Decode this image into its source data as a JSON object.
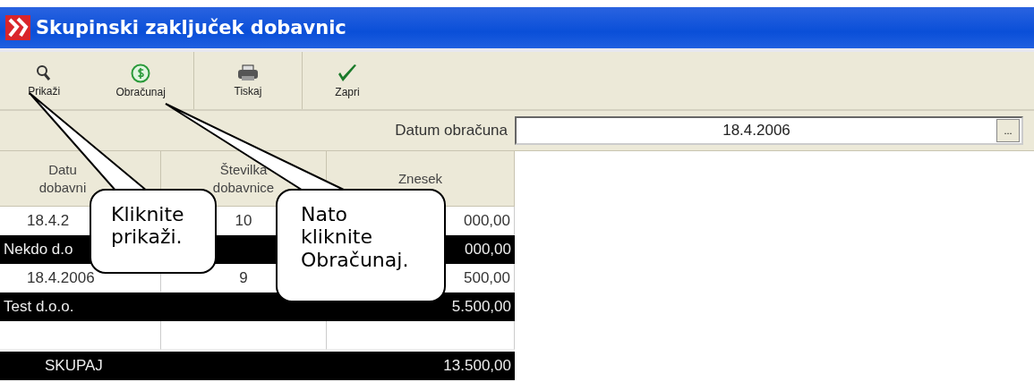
{
  "window": {
    "title": "Skupinski zaključek dobavnic"
  },
  "toolbar": [
    {
      "label": "Prikaži"
    },
    {
      "label": "Obračunaj"
    },
    {
      "label": "Tiskaj"
    },
    {
      "label": "Zapri"
    }
  ],
  "date_field": {
    "label": "Datum obračuna",
    "value": "18.4.2006",
    "button": "..."
  },
  "table": {
    "columns": [
      "Datu dobavni",
      "Številka dobavnice",
      "Znesek"
    ],
    "rows": [
      {
        "kind": "item",
        "cells": [
          "18.4.2",
          "10",
          "000,00"
        ]
      },
      {
        "kind": "group",
        "cells": [
          "Nekdo d.o",
          "000,00"
        ]
      },
      {
        "kind": "item",
        "cells": [
          "18.4.2006",
          "9",
          "500,00"
        ]
      },
      {
        "kind": "group",
        "cells": [
          "Test d.o.o.",
          "5.500,00"
        ]
      },
      {
        "kind": "blank",
        "cells": []
      },
      {
        "kind": "total",
        "cells": [
          "SKUPAJ",
          "13.500,00"
        ]
      }
    ]
  },
  "callouts": [
    {
      "lines": [
        "Kliknite",
        "prikaži."
      ]
    },
    {
      "lines": [
        "Nato",
        "kliknite",
        "Obračunaj."
      ]
    }
  ]
}
